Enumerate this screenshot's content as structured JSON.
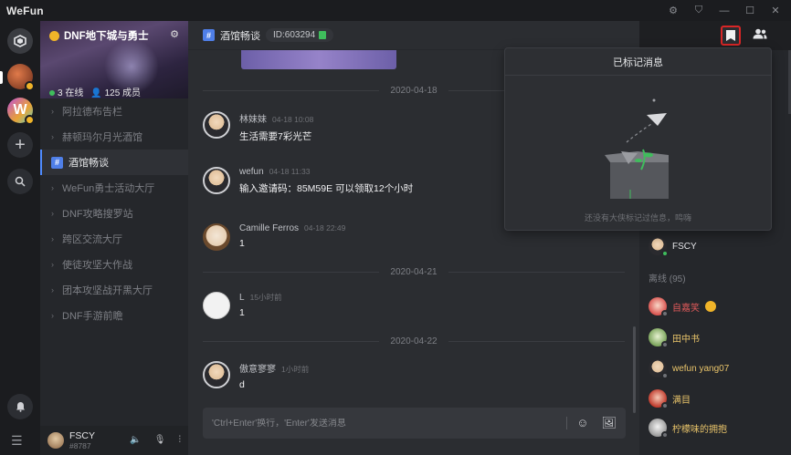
{
  "app": {
    "title": "WeFun"
  },
  "window_controls": [
    "⚙",
    "⛉",
    "—",
    "☐",
    "✕"
  ],
  "server": {
    "name": "DNF地下城与勇士",
    "online": "3 在线",
    "members": "125 成员"
  },
  "channels": [
    {
      "label": "阿拉德布告栏",
      "active": false
    },
    {
      "label": "赫顿玛尔月光酒馆",
      "active": false
    },
    {
      "label": "酒馆畅谈",
      "active": true
    },
    {
      "label": "WeFun勇士活动大厅",
      "active": false
    },
    {
      "label": "DNF攻略搜罗站",
      "active": false
    },
    {
      "label": "跨区交流大厅",
      "active": false
    },
    {
      "label": "使徒攻坚大作战",
      "active": false
    },
    {
      "label": "团本攻坚战开黑大厅",
      "active": false
    },
    {
      "label": "DNF手游前瞻",
      "active": false
    }
  ],
  "current_user": {
    "name": "FSCY",
    "id": "#8787"
  },
  "chat": {
    "channel_title": "酒馆畅谈",
    "channel_id": "ID:603294",
    "dates": [
      "2020-04-18",
      "2020-04-21",
      "2020-04-22"
    ],
    "messages": [
      {
        "author": "林妹妹",
        "time": "04-18 10:08",
        "text": "生活需要7彩光芒"
      },
      {
        "author": "wefun",
        "time": "04-18 11:33",
        "text": "输入邀请码：85M59E 可以领取12个小时"
      },
      {
        "author": "Camille Ferros",
        "time": "04-18 22:49",
        "text": "1"
      },
      {
        "author": "L",
        "time": "15小时前",
        "text": "1"
      },
      {
        "author": "傲意寥寥",
        "time": "1小时前",
        "text": "d"
      }
    ],
    "composer_placeholder": "'Ctrl+Enter'换行，'Enter'发送消息"
  },
  "popover": {
    "title": "已标记消息",
    "empty_text": "还没有大侠标记过信息，鸣嗨"
  },
  "members": {
    "online_member": "FSCY",
    "offline_label": "离线 (95)",
    "offline": [
      {
        "name": "自嘉笑",
        "color": "#e05a5a"
      },
      {
        "name": "田中书",
        "color": "#e9c46a"
      },
      {
        "name": "wefun yang07",
        "color": "#e9c46a"
      },
      {
        "name": "满目",
        "color": "#e9c46a"
      },
      {
        "name": "柠檬味的拥抱",
        "color": "#e9c46a"
      }
    ]
  },
  "colors": {
    "accent": "#4f8bff",
    "highlight_border": "#d92626",
    "online": "#3fbd5c"
  }
}
